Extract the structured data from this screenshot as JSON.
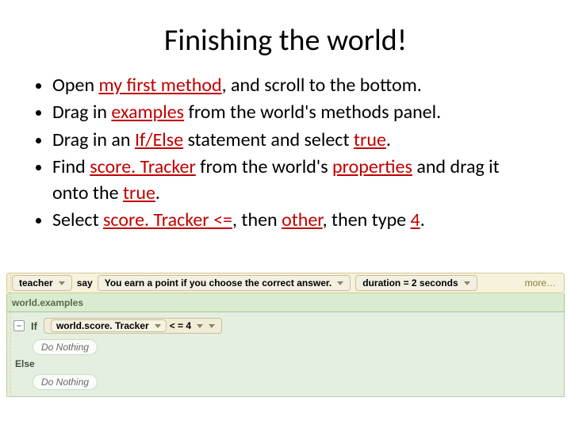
{
  "title": "Finishing the world!",
  "bullets": {
    "b1": {
      "pre": "Open ",
      "em": "my first method",
      "post": ", and scroll to the bottom."
    },
    "b2": {
      "pre": "Drag in ",
      "em": "examples",
      "post": " from the world's methods panel."
    },
    "b3": {
      "pre": "Drag in an ",
      "em": "If/Else",
      "mid": " statement and select ",
      "em2": "true",
      "post": "."
    },
    "b4": {
      "pre": "Find ",
      "em": "score. Tracker",
      "mid": " from the world's ",
      "em2": "properties",
      "mid2": " and drag it onto the ",
      "em3": "true",
      "post": "."
    },
    "b5": {
      "pre": "Select ",
      "em": "score. Tracker <=",
      "mid": ", then ",
      "em2": "other",
      "mid2": ", then type ",
      "em3": "4",
      "post": "."
    }
  },
  "code": {
    "say": {
      "obj": "teacher",
      "method": "say",
      "text": "You earn a point if you choose the correct answer.",
      "duration_label": "duration = 2 seconds",
      "more": "more…"
    },
    "examples_label": "world.examples",
    "if_label": "If",
    "expr_obj": "world.score. Tracker",
    "expr_op": "< = 4",
    "do_nothing": "Do Nothing",
    "else_label": "Else"
  }
}
